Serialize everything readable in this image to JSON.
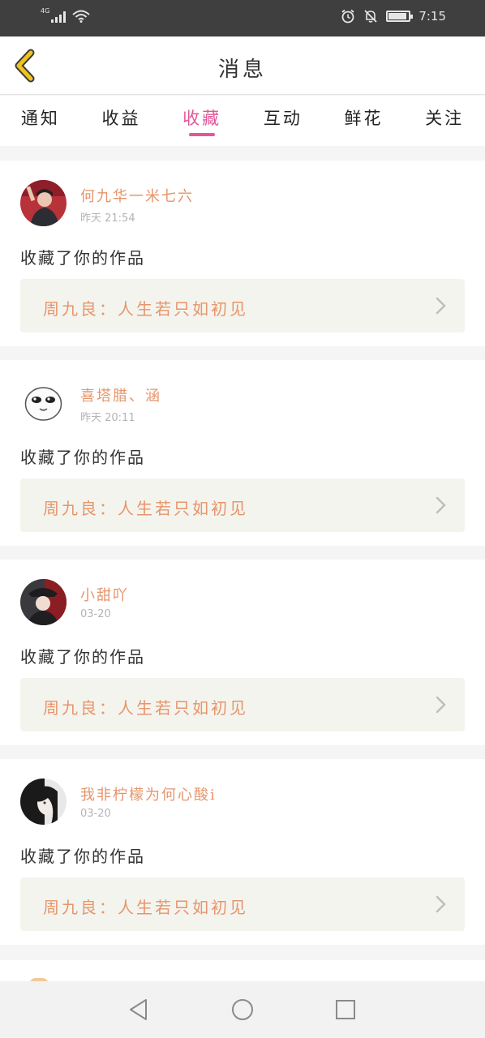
{
  "status_bar": {
    "network": "4G",
    "time": "7:15",
    "battery_level": 0.9,
    "icons": [
      "signal-icon",
      "wifi-icon",
      "alarm-icon",
      "mute-icon",
      "battery-icon"
    ]
  },
  "header": {
    "title": "消息",
    "back_icon": "chevron-left-icon",
    "back_color": "#f0c419"
  },
  "tabs": [
    {
      "label": "通知",
      "active": false
    },
    {
      "label": "收益",
      "active": false
    },
    {
      "label": "收藏",
      "active": true
    },
    {
      "label": "互动",
      "active": false
    },
    {
      "label": "鲜花",
      "active": false
    },
    {
      "label": "关注",
      "active": false
    }
  ],
  "colors": {
    "accent": "#e0589a",
    "name": "#e6956b",
    "work_bg": "#f4f4ee"
  },
  "messages": [
    {
      "user": "何九华一米七六",
      "time": "昨天 21:54",
      "action": "收藏了你的作品",
      "work": "周九良：人生若只如初见"
    },
    {
      "user": "喜塔腊、涵",
      "time": "昨天 20:11",
      "action": "收藏了你的作品",
      "work": "周九良：人生若只如初见"
    },
    {
      "user": "小甜吖",
      "time": "03-20",
      "action": "收藏了你的作品",
      "work": "周九良：人生若只如初见"
    },
    {
      "user": "我非柠檬为何心酸i",
      "time": "03-20",
      "action": "收藏了你的作品",
      "work": "周九良：人生若只如初见"
    }
  ]
}
